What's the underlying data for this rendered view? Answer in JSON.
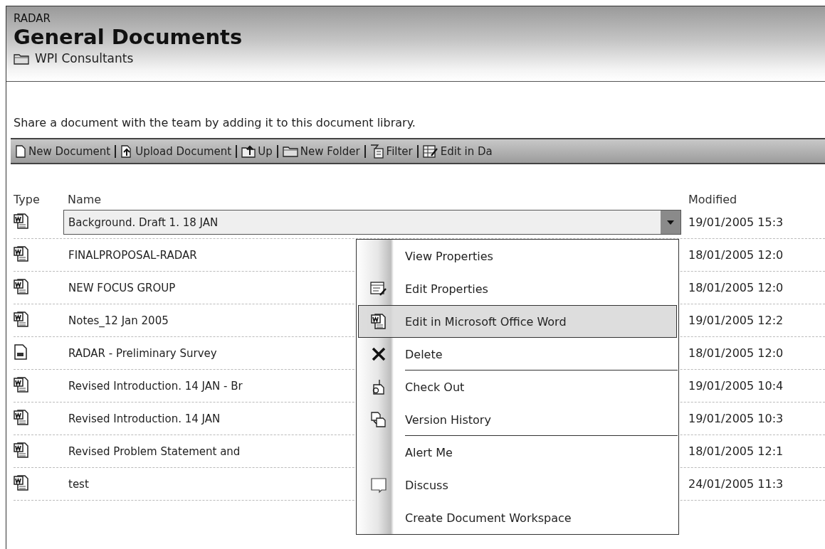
{
  "breadcrumb": "RADAR",
  "title": "General Documents",
  "site": "WPI Consultants",
  "description": "Share a document with the team by adding it to this document library.",
  "toolbar": [
    {
      "label": "New Document"
    },
    {
      "label": "Upload Document"
    },
    {
      "label": "Up"
    },
    {
      "label": "New Folder"
    },
    {
      "label": "Filter"
    },
    {
      "label": "Edit in Da"
    }
  ],
  "table": {
    "columns": [
      "Type",
      "Name",
      "Modified"
    ],
    "rows": [
      {
        "kind": "word",
        "name": "Background. Draft 1. 18 JAN",
        "modified": "19/01/2005 15:3",
        "selected": true
      },
      {
        "kind": "word",
        "name": "FINALPROPOSAL-RADAR",
        "modified": "18/01/2005 12:0",
        "selected": false
      },
      {
        "kind": "word",
        "name": "NEW FOCUS GROUP",
        "modified": "18/01/2005 12:0",
        "selected": false
      },
      {
        "kind": "word",
        "name": "Notes_12 Jan 2005",
        "modified": "19/01/2005 12:2",
        "selected": false
      },
      {
        "kind": "other",
        "name": "RADAR - Preliminary Survey",
        "modified": "18/01/2005 12:0",
        "selected": false
      },
      {
        "kind": "word",
        "name": "Revised Introduction. 14 JAN - Br",
        "modified": "19/01/2005 10:4",
        "selected": false
      },
      {
        "kind": "word",
        "name": "Revised Introduction. 14 JAN",
        "modified": "19/01/2005 10:3",
        "selected": false
      },
      {
        "kind": "word",
        "name": "Revised Problem Statement and",
        "modified": "18/01/2005 12:1",
        "selected": false
      },
      {
        "kind": "word",
        "name": "test",
        "modified": "24/01/2005 11:3",
        "selected": false
      }
    ]
  },
  "context_menu": [
    {
      "label": "View Properties",
      "selected": false,
      "separator_after": false
    },
    {
      "label": "Edit Properties",
      "selected": false,
      "separator_after": false
    },
    {
      "label": "Edit in Microsoft Office Word",
      "selected": true,
      "separator_after": false
    },
    {
      "label": "Delete",
      "selected": false,
      "separator_after": true
    },
    {
      "label": "Check Out",
      "selected": false,
      "separator_after": false
    },
    {
      "label": "Version History",
      "selected": false,
      "separator_after": true
    },
    {
      "label": "Alert Me",
      "selected": false,
      "separator_after": false
    },
    {
      "label": "Discuss",
      "selected": false,
      "separator_after": false
    },
    {
      "label": "Create Document Workspace",
      "selected": false,
      "separator_after": false
    }
  ]
}
